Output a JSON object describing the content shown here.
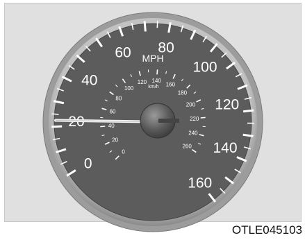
{
  "figure_code": "OTLE045103",
  "gauge": {
    "unit_primary": "MPH",
    "unit_secondary": "km/h",
    "mph_labels": [
      "0",
      "20",
      "40",
      "60",
      "80",
      "100",
      "120",
      "140",
      "160"
    ],
    "kmh_labels": [
      "0",
      "20",
      "40",
      "60",
      "80",
      "100",
      "120",
      "140",
      "160",
      "180",
      "200",
      "220",
      "240",
      "260"
    ],
    "needle_value_mph": 20
  },
  "colors": {
    "background": "#e0e0e0",
    "dial_face": "#5c5c5c",
    "bezel": "#a4a4a4",
    "markings": "#ffffff",
    "needle": "#efefef"
  }
}
